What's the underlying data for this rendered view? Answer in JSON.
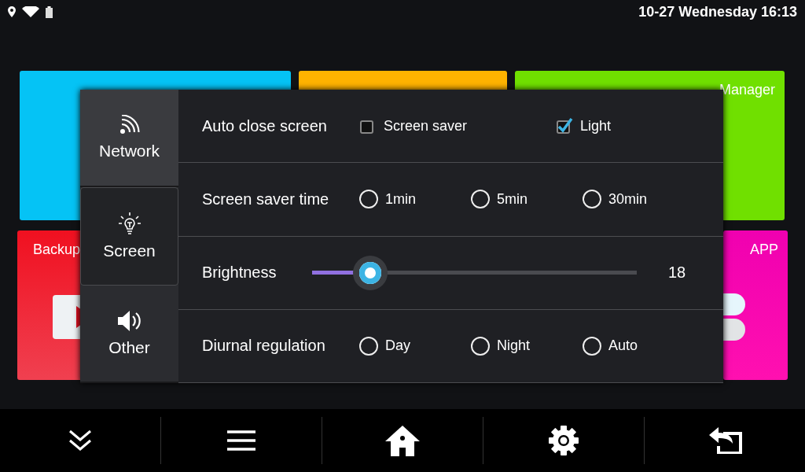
{
  "status_bar": {
    "datetime": "10-27 Wednesday 16:13"
  },
  "tiles": [
    {
      "color": "#05c3f5"
    },
    {
      "color": "#ffb300"
    },
    {
      "label": "Manager",
      "color": "#70e000"
    },
    {
      "label": "Backup",
      "color": "#f01020"
    },
    {
      "label": "APP",
      "color": "#f000b0"
    }
  ],
  "dialog": {
    "tabs": [
      {
        "label": "Network",
        "selected": false
      },
      {
        "label": "Screen",
        "selected": true
      },
      {
        "label": "Other",
        "selected": false
      }
    ],
    "rows": [
      {
        "kind": "checkbox",
        "label": "Auto close screen",
        "options": [
          {
            "label": "Screen saver",
            "checked": false
          },
          {
            "label": "Light",
            "checked": true
          }
        ]
      },
      {
        "kind": "radio",
        "label": "Screen saver time",
        "options": [
          {
            "label": "1min",
            "selected": false
          },
          {
            "label": "5min",
            "selected": false
          },
          {
            "label": "30min",
            "selected": false
          }
        ]
      },
      {
        "kind": "slider",
        "label": "Brightness",
        "level": 0.18,
        "reading": "18"
      },
      {
        "kind": "radio",
        "label": "Diurnal regulation",
        "options": [
          {
            "label": "Day",
            "selected": false
          },
          {
            "label": "Night",
            "selected": false
          },
          {
            "label": "Auto",
            "selected": false
          }
        ]
      }
    ]
  }
}
